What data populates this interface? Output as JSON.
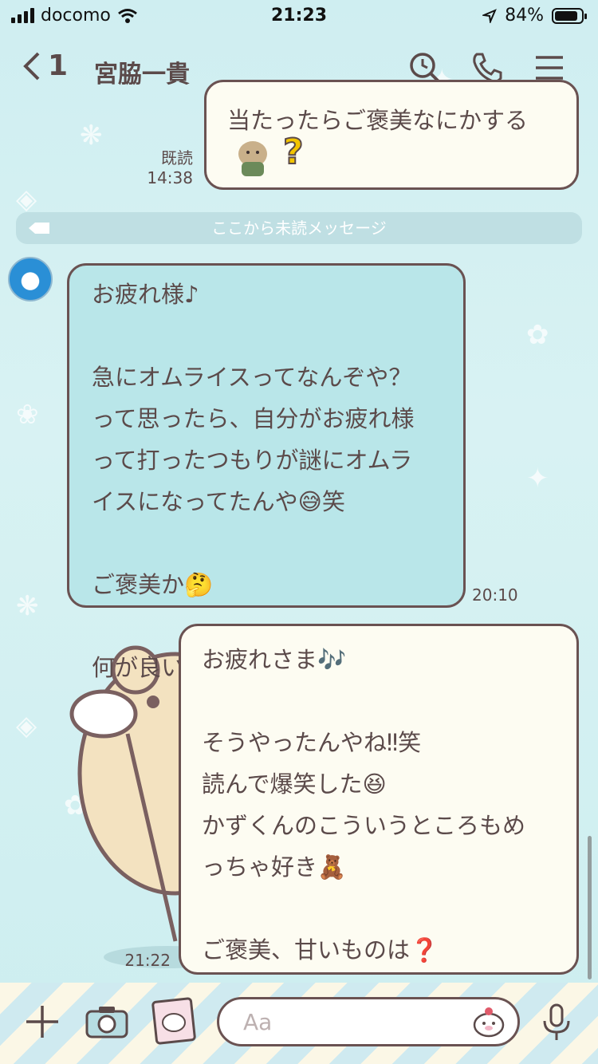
{
  "status_bar": {
    "carrier": "docomo",
    "time": "21:23",
    "battery": "84%"
  },
  "header": {
    "back_count": "1",
    "title": "宮脇一貴"
  },
  "unread_divider": "ここから未読メッセージ",
  "messages": [
    {
      "from": "me",
      "text": "当たったらご褒美なにかする",
      "sticker_mark": "?",
      "read_label": "既読",
      "time": "14:38"
    },
    {
      "from": "them",
      "text": "お疲れ様♪\n\n急にオムライスってなんぞや？\nって思ったら、自分がお疲れ様\nって打ったつもりが謎にオムラ\nイスになってたんや😅笑\n\nご褒美か🤔\n\n何が良いかなー？🙄",
      "time": "20:10"
    },
    {
      "from": "me",
      "text": "お疲れさま🎶\n\nそうやったんやね‼︎笑\n読んで爆笑した😆\nかずくんのこういうところもめ\nっちゃ好き🧸\n\nご褒美、甘いものは❓",
      "time": "21:22"
    }
  ],
  "input": {
    "placeholder": "Aa"
  },
  "colors": {
    "accent": "#6a5252",
    "bubble_mine": "#fdfcf2",
    "bubble_theirs": "#b9e6e9"
  }
}
